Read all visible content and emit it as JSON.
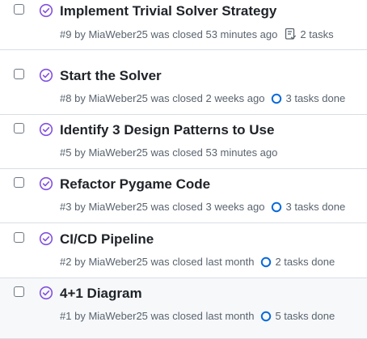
{
  "issues": [
    {
      "title": "Implement Trivial Solver Strategy",
      "number": "#9",
      "author": "MiaWeber25",
      "closed": "53 minutes ago",
      "tasks": "2 tasks",
      "task_icon": "checklist-icon"
    },
    {
      "title": "Start the Solver",
      "number": "#8",
      "author": "MiaWeber25",
      "closed": "2 weeks ago",
      "tasks": "3 tasks done",
      "task_icon": "progress-circle-icon"
    },
    {
      "title": "Identify 3 Design Patterns to Use",
      "number": "#5",
      "author": "MiaWeber25",
      "closed": "53 minutes ago",
      "tasks": "",
      "task_icon": ""
    },
    {
      "title": "Refactor Pygame Code",
      "number": "#3",
      "author": "MiaWeber25",
      "closed": "3 weeks ago",
      "tasks": "3 tasks done",
      "task_icon": "progress-circle-icon"
    },
    {
      "title": "CI/CD Pipeline",
      "number": "#2",
      "author": "MiaWeber25",
      "closed": "last month",
      "tasks": "2 tasks done",
      "task_icon": "progress-circle-icon"
    },
    {
      "title": "4+1 Diagram",
      "number": "#1",
      "author": "MiaWeber25",
      "closed": "last month",
      "tasks": "5 tasks done",
      "task_icon": "progress-circle-icon"
    }
  ],
  "labels": {
    "by": "by",
    "was_closed": "was closed"
  },
  "colors": {
    "closed_purple": "#8250df",
    "progress_blue": "#0969da",
    "meta_gray": "#59636e"
  }
}
